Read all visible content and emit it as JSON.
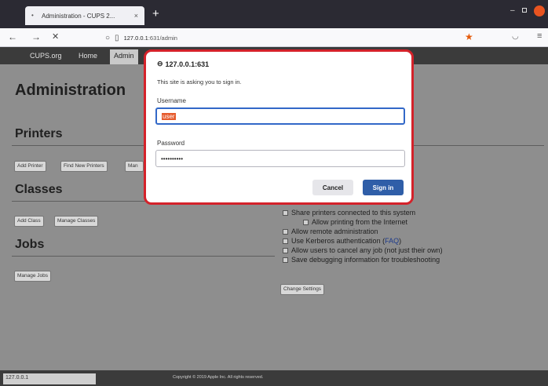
{
  "browser": {
    "tab_title": "Administration - CUPS 2...",
    "tab_close": "×",
    "new_tab": "+",
    "back": "←",
    "forward": "→",
    "reload": "✕",
    "url_host": "127.0.0.1",
    "url_rest": ":631/admin",
    "status_url": "127.0.0.1"
  },
  "cups": {
    "nav": [
      "CUPS.org",
      "Home",
      "Admin"
    ],
    "title": "Administration",
    "printers_heading": "Printers",
    "printers_buttons": [
      "Add Printer",
      "Find New Printers",
      "Man"
    ],
    "classes_heading": "Classes",
    "classes_buttons": [
      "Add Class",
      "Manage Classes"
    ],
    "jobs_heading": "Jobs",
    "jobs_buttons": [
      "Manage Jobs"
    ],
    "settings": {
      "share": "Share printers connected to this system",
      "allow_internet": "Allow printing from the Internet",
      "remote_admin": "Allow remote administration",
      "kerberos": "Use Kerberos authentication (",
      "kerberos_link": "FAQ",
      "kerberos_end": ")",
      "cancel_jobs": "Allow users to cancel any job (not just their own)",
      "debug": "Save debugging information for troubleshooting",
      "change_button": "Change Settings"
    },
    "copyright": "Copyright © 2019 Apple Inc. All rights reserved."
  },
  "dialog": {
    "host": "127.0.0.1:631",
    "message": "This site is asking you to sign in.",
    "username_label": "Username",
    "username_value": "user",
    "password_label": "Password",
    "password_value": "••••••••••",
    "cancel_label": "Cancel",
    "signin_label": "Sign in"
  },
  "colors": {
    "accent": "#2f5ea8",
    "dialog_border": "#d4222a",
    "ubuntu_close": "#e95420"
  }
}
